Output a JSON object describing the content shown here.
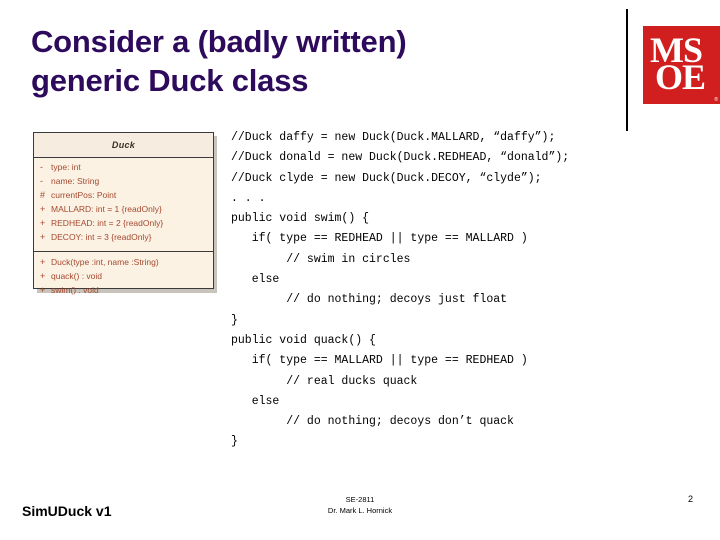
{
  "slide": {
    "title_lines": [
      "Consider a (badly written)",
      "generic Duck class"
    ],
    "title_color": "#2e0a5c",
    "background_color": "#ffffff"
  },
  "logo": {
    "name": "msoe-logo",
    "line1": "MS",
    "line2": "OE",
    "trademark": "®",
    "square_color": "#d11f1f",
    "text_color": "#ffffff",
    "rule_color": "#000000"
  },
  "uml": {
    "class_name": "Duck",
    "accent_color": "#a5492f",
    "fill_color": "#fbf2e4",
    "border_color": "#3a3a3a",
    "attributes": [
      {
        "visibility": "-",
        "signature": "type:  int"
      },
      {
        "visibility": "-",
        "signature": "name:  String"
      },
      {
        "visibility": "#",
        "signature": "currentPos:  Point"
      },
      {
        "visibility": "+",
        "signature": "MALLARD:  int = 1 {readOnly}"
      },
      {
        "visibility": "+",
        "signature": "REDHEAD:  int = 2 {readOnly}"
      },
      {
        "visibility": "+",
        "signature": "DECOY:  int = 3 {readOnly}"
      }
    ],
    "operations": [
      {
        "visibility": "+",
        "signature": "Duck(type :int,  name :String)"
      },
      {
        "visibility": "+",
        "signature": "quack() : void"
      },
      {
        "visibility": "+",
        "signature": "swim() : void"
      }
    ]
  },
  "code": {
    "lines": [
      "//Duck daffy = new Duck(Duck.MALLARD, “daffy”);",
      "//Duck donald = new Duck(Duck.REDHEAD, “donald”);",
      "//Duck clyde = new Duck(Duck.DECOY, “clyde”);",
      ". . .",
      "public void swim() {",
      "   if( type == REDHEAD || type == MALLARD )",
      "        // swim in circles",
      "   else",
      "        // do nothing; decoys just float",
      "}",
      "public void quack() {",
      "   if( type == MALLARD || type == REDHEAD )",
      "        // real ducks quack",
      "   else",
      "        // do nothing; decoys don’t quack",
      "}"
    ]
  },
  "footer": {
    "left_label": "SimUDuck v1",
    "course": "SE-2811",
    "instructor": "Dr. Mark L. Hornick",
    "page_number": "2"
  }
}
